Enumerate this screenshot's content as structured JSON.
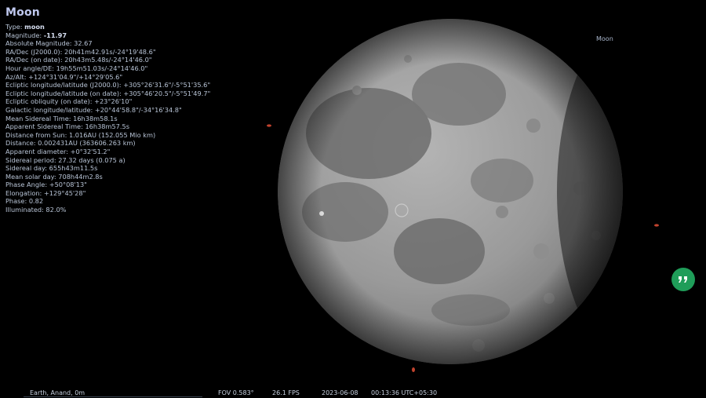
{
  "info": {
    "title": "Moon",
    "lines": [
      {
        "label": "Type: ",
        "value": "moon",
        "bold": true
      },
      {
        "label": "Magnitude: ",
        "value": "-11.97",
        "bold": true
      },
      {
        "label": "Absolute Magnitude: ",
        "value": "32.67"
      },
      {
        "label": "RA/Dec (J2000.0): ",
        "value": "20h41m42.91s/-24°19'48.6\""
      },
      {
        "label": "RA/Dec (on date): ",
        "value": "20h43m5.48s/-24°14'46.0\""
      },
      {
        "label": "Hour angle/DE: ",
        "value": "19h55m51.03s/-24°14'46.0\""
      },
      {
        "label": "Az/Alt: ",
        "value": "+124°31'04.9\"/+14°29'05.6\""
      },
      {
        "label": "Ecliptic longitude/latitude (J2000.0): ",
        "value": "+305°26'31.6\"/-5°51'35.6\""
      },
      {
        "label": "Ecliptic longitude/latitude (on date): ",
        "value": "+305°46'20.5\"/-5°51'49.7\""
      },
      {
        "label": "Ecliptic obliquity (on date): ",
        "value": "+23°26'10\""
      },
      {
        "label": "Galactic longitude/latitude: ",
        "value": "+20°44'58.8\"/-34°16'34.8\""
      },
      {
        "label": "Mean Sidereal Time: ",
        "value": "16h38m58.1s"
      },
      {
        "label": "Apparent Sidereal Time: ",
        "value": "16h38m57.5s"
      },
      {
        "label": "Distance from Sun: ",
        "value": "1.016AU (152.055 Mio km)"
      },
      {
        "label": "Distance: ",
        "value": "0.002431AU (363606.263 km)"
      },
      {
        "label": "Apparent diameter: ",
        "value": "+0°32'51.2\""
      },
      {
        "label": "Sidereal period: ",
        "value": "27.32 days (0.075 a)"
      },
      {
        "label": "Sidereal day: ",
        "value": "655h43m11.5s"
      },
      {
        "label": "Mean solar day: ",
        "value": "708h44m2.8s"
      },
      {
        "label": "Phase Angle: ",
        "value": "+50°08'13\""
      },
      {
        "label": "Elongation: ",
        "value": "+129°45'28\""
      },
      {
        "label": "Phase: ",
        "value": "0.82"
      },
      {
        "label": "Illuminated: ",
        "value": "82.0%"
      }
    ]
  },
  "sky": {
    "object_label": "Moon",
    "moon_phase_illuminated": 0.82
  },
  "fab": {
    "icon": "quote-icon",
    "color": "#1f9d59"
  },
  "status_bar": {
    "location": "Earth, Anand, 0m",
    "fov": "FOV 0.583°",
    "fps": "26.1 FPS",
    "date": "2023-06-08",
    "time": "00:13:36 UTC+05:30"
  }
}
